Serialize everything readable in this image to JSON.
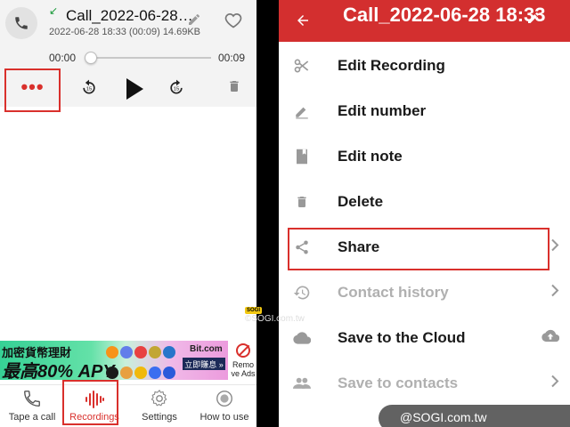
{
  "left": {
    "recording": {
      "title": "Call_2022-06-28…",
      "meta": "2022-06-28 18:33  (00:09)  14.69KB",
      "time_start": "00:00",
      "time_end": "00:09",
      "progress": 0
    },
    "controls": {
      "more_label": "•••",
      "rewind_label": "15",
      "forward_label": "15"
    },
    "ad": {
      "line1": "加密貨幣理財",
      "line2": "最高80% APY",
      "brand": "Bit.com",
      "cta": "立即賺息 »",
      "remove_label": "Remo ve Ads"
    },
    "nav": [
      {
        "label": "Tape a call",
        "icon": "phone-icon"
      },
      {
        "label": "Recordings",
        "icon": "waveform-icon"
      },
      {
        "label": "Settings",
        "icon": "gear-icon"
      },
      {
        "label": "How to use",
        "icon": "circle-icon"
      }
    ],
    "active_nav": "Recordings"
  },
  "watermark_mid": {
    "badge": "SOGI",
    "text": "©SOGI.com.tw"
  },
  "right": {
    "title": "Call_2022-06-28 18:33",
    "menu": [
      {
        "label": "Edit Recording",
        "icon": "scissors-icon",
        "enabled": true
      },
      {
        "label": "Edit number",
        "icon": "pencil-icon",
        "enabled": true
      },
      {
        "label": "Edit note",
        "icon": "note-icon",
        "enabled": true
      },
      {
        "label": "Delete",
        "icon": "trash-icon",
        "enabled": true
      },
      {
        "label": "Share",
        "icon": "share-icon",
        "enabled": true
      },
      {
        "label": "Contact history",
        "icon": "history-icon",
        "enabled": false
      },
      {
        "label": "Save to the Cloud",
        "icon": "cloud-icon",
        "enabled": true
      },
      {
        "label": "Save to contacts",
        "icon": "contacts-icon",
        "enabled": false
      }
    ]
  },
  "watermark_bottom": "@SOGI.com.tw",
  "colors": {
    "accent": "#d32f2f",
    "highlight_box": "#d9302c",
    "disabled": "#b0b0b0"
  }
}
